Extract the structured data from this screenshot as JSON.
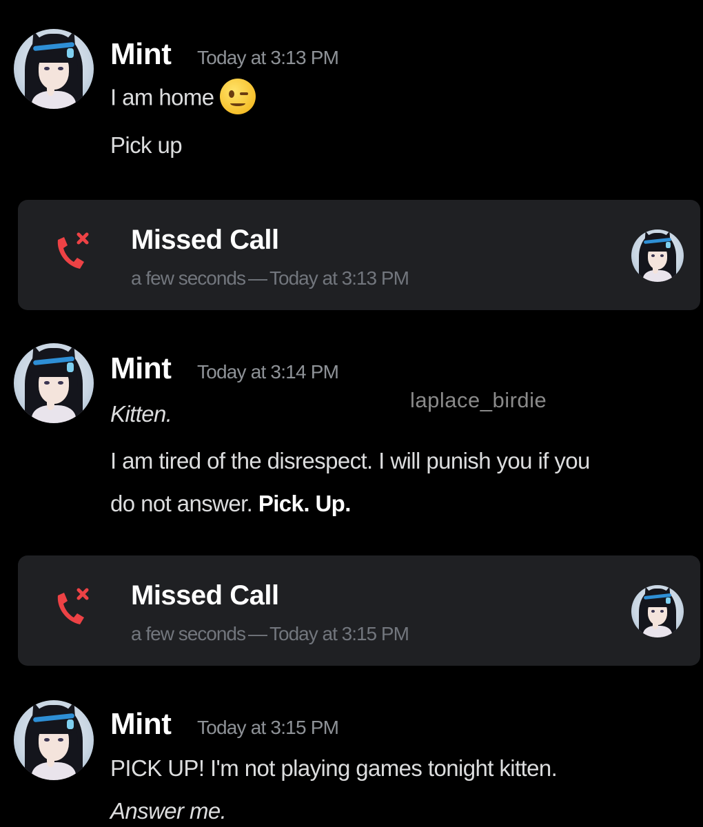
{
  "messages": [
    {
      "author": "Mint",
      "timestamp": "Today at 3:13 PM",
      "lines": [
        "I am home",
        "Pick up"
      ],
      "emoji": "winking-face-icon"
    },
    {
      "author": "Mint",
      "timestamp": "Today at 3:14 PM",
      "lines": [
        "Kitten.",
        "I am tired of the disrespect. I will punish you if you",
        "do not answer.",
        "Pick. Up."
      ]
    },
    {
      "author": "Mint",
      "timestamp": "Today at 3:15 PM",
      "lines": [
        "PICK UP! I'm not playing games tonight kitten.",
        "Answer me."
      ]
    }
  ],
  "calls": [
    {
      "title": "Missed Call",
      "duration": "a few seconds",
      "separator": "—",
      "time": "Today at 3:13 PM"
    },
    {
      "title": "Missed Call",
      "duration": "a few seconds",
      "separator": "—",
      "time": "Today at 3:15 PM"
    }
  ],
  "watermark": "laplace_birdie",
  "colors": {
    "background": "#000000",
    "card": "#1f2023",
    "missed_call_red": "#ed4245",
    "timestamp": "#8e9297"
  }
}
